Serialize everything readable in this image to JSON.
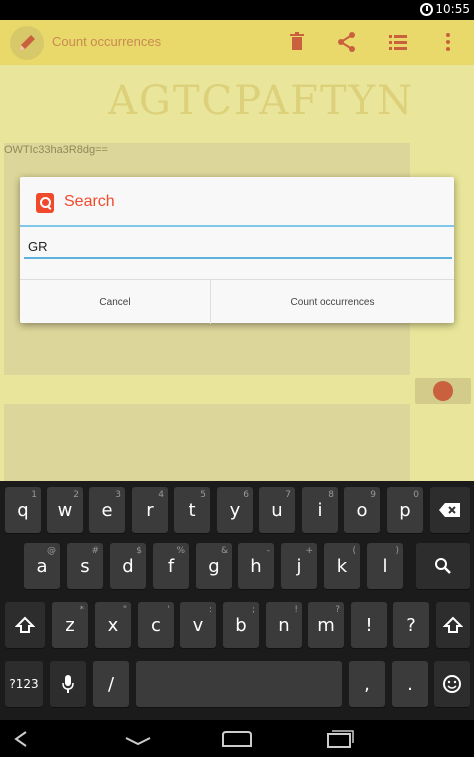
{
  "status": {
    "time": "10:55",
    "alarm_icon": "alarm-clock-icon"
  },
  "app": {
    "title": "Count occurrences",
    "sequence": "AGTCPAFTYN",
    "sequence_id": "OWTIc33ha3R8dg==",
    "icons": [
      "pencil-icon",
      "trash-icon",
      "share-icon",
      "list-icon",
      "overflow-menu-icon"
    ],
    "accent": "#e8d96a"
  },
  "dialog": {
    "title": "Search",
    "input_value": "GR",
    "cancel_label": "Cancel",
    "confirm_label": "Count occurrences",
    "accent": "#f04a2d",
    "underline": "#5eb2db"
  },
  "keyboard": {
    "row1": [
      {
        "key": "q",
        "hint": "1"
      },
      {
        "key": "w",
        "hint": "2"
      },
      {
        "key": "e",
        "hint": "3"
      },
      {
        "key": "r",
        "hint": "4"
      },
      {
        "key": "t",
        "hint": "5"
      },
      {
        "key": "y",
        "hint": "6"
      },
      {
        "key": "u",
        "hint": "7"
      },
      {
        "key": "i",
        "hint": "8"
      },
      {
        "key": "o",
        "hint": "9"
      },
      {
        "key": "p",
        "hint": "0"
      }
    ],
    "row2": [
      {
        "key": "a",
        "hint": "@"
      },
      {
        "key": "s",
        "hint": "#"
      },
      {
        "key": "d",
        "hint": "$"
      },
      {
        "key": "f",
        "hint": "%"
      },
      {
        "key": "g",
        "hint": "&"
      },
      {
        "key": "h",
        "hint": "-"
      },
      {
        "key": "j",
        "hint": "+"
      },
      {
        "key": "k",
        "hint": "("
      },
      {
        "key": "l",
        "hint": ")"
      }
    ],
    "row3": [
      {
        "key": "z",
        "hint": "*"
      },
      {
        "key": "x",
        "hint": "\""
      },
      {
        "key": "c",
        "hint": "'"
      },
      {
        "key": "v",
        "hint": ":"
      },
      {
        "key": "b",
        "hint": ";"
      },
      {
        "key": "n",
        "hint": "!"
      },
      {
        "key": "m",
        "hint": "?"
      },
      {
        "key": "!",
        "hint": ""
      },
      {
        "key": "?",
        "hint": ""
      }
    ],
    "symbols_label": "?123",
    "slash": "/",
    "comma": ",",
    "period": "."
  }
}
